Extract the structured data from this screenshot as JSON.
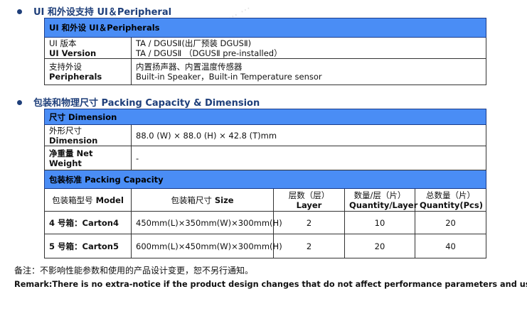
{
  "ui_section": {
    "title": "UI 和外设支持 UI＆Peripheral",
    "table_header": "UI 和外设  UI＆Peripherals",
    "rows": [
      {
        "label_cn": "UI 版本",
        "label_en": "UI Version",
        "value_1": "TA / DGUSⅡ(出厂预装 DGUSⅡ)",
        "value_2": "TA / DGUSⅡ （DGUSⅡ  pre-installed）"
      },
      {
        "label_cn": "支持外设",
        "label_en": "Peripherals",
        "value_1": "内置扬声器、内置温度传感器",
        "value_2": "Built-in Speaker，Built-in Temperature sensor"
      }
    ]
  },
  "packing_section": {
    "title": "包装和物理尺寸 Packing Capacity & Dimension",
    "dimension_header": "尺寸  Dimension",
    "dimension_label_cn": "外形尺寸",
    "dimension_label_en": "Dimension",
    "dimension_value": "88.0 (W) × 88.0 (H) × 42.8 (T)mm",
    "net_weight_label_cn": "净重量",
    "net_weight_label_en": "Net Weight",
    "net_weight_value": "-",
    "capacity_header": "包装标准  Packing Capacity",
    "columns": {
      "model_cn": "包装箱型号",
      "model_en": "Model",
      "size_cn": "包装箱尺寸",
      "size_en": "Size",
      "layer_cn": "层数（层）",
      "layer_en": "Layer",
      "qty_layer_cn": "数量/层（片）",
      "qty_layer_en": "Quantity/Layer",
      "qty_total_cn": "总数量（片）",
      "qty_total_en": "Quantity(Pcs)"
    },
    "cartons": [
      {
        "model": "4 号箱：Carton4",
        "size": "450mm(L)×350mm(W)×300mm(H)",
        "layer": "2",
        "qty_layer": "10",
        "qty_total": "20"
      },
      {
        "model": "5 号箱：Carton5",
        "size": "600mm(L)×450mm(W)×300mm(H)",
        "layer": "2",
        "qty_layer": "20",
        "qty_total": "40"
      }
    ]
  },
  "note_cn": "备注：不影响性能参数和使用的产品设计变更，恕不另行通知。",
  "remark_en": "Remark:There is no extra-notice if the product design changes that do not affect performance parameters and use",
  "colors": {
    "header_fill": "#4a8df5",
    "section_title": "#1f3f7a"
  }
}
